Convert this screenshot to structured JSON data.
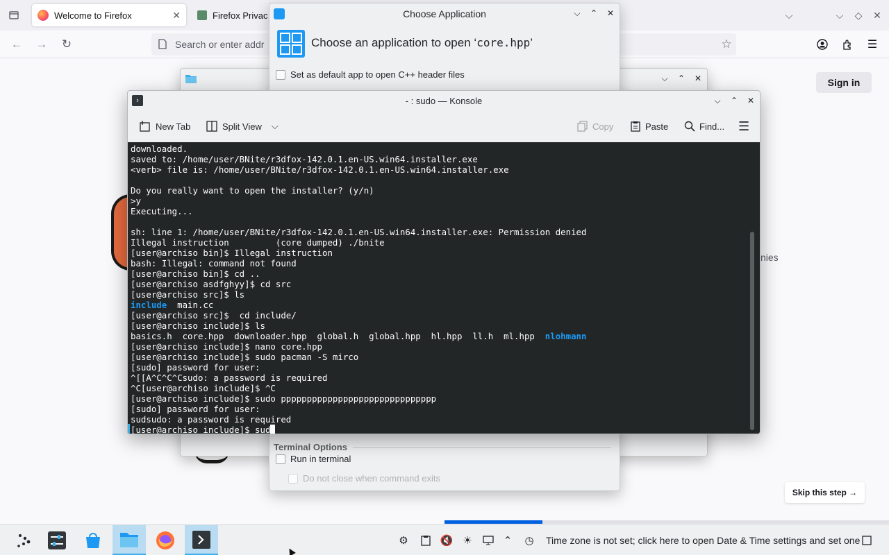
{
  "firefox": {
    "tabs": [
      {
        "title": "Welcome to Firefox",
        "active": true
      },
      {
        "title": "Firefox Privac",
        "active": false
      }
    ],
    "urlbar_placeholder": "Search or enter addr",
    "sign_in": "Sign in",
    "partial_text": "nies",
    "skip_step": "Skip this step →",
    "onboarding_progress": 0.22
  },
  "choose_app": {
    "title": "Choose Application",
    "heading_prefix": "Choose an application to open ‘",
    "heading_file": "core.hpp",
    "heading_suffix": "’",
    "default_checkbox": "Set as default app to open C++ header files",
    "terminal_options_label": "Terminal Options",
    "run_in_terminal": "Run in terminal",
    "do_not_close": "Do not close when command exits"
  },
  "konsole": {
    "title": "- : sudo — Konsole",
    "toolbar": {
      "new_tab": "New Tab",
      "split_view": "Split View",
      "copy": "Copy",
      "paste": "Paste",
      "find": "Find..."
    },
    "lines": [
      [
        {
          "t": "downloaded."
        }
      ],
      [
        {
          "t": "saved to: /home/user/BNite/r3dfox-142.0.1.en-US.win64.installer.exe"
        }
      ],
      [
        {
          "t": "<verb> file is: /home/user/BNite/r3dfox-142.0.1.en-US.win64.installer.exe"
        }
      ],
      [
        {
          "t": ""
        }
      ],
      [
        {
          "t": "Do you really want to open the installer? (y/n)"
        }
      ],
      [
        {
          "t": ">y"
        }
      ],
      [
        {
          "t": "Executing..."
        }
      ],
      [
        {
          "t": ""
        }
      ],
      [
        {
          "t": "sh: line 1: /home/user/BNite/r3dfox-142.0.1.en-US.win64.installer.exe: Permission denied"
        }
      ],
      [
        {
          "t": "Illegal instruction         (core dumped) ./bnite"
        }
      ],
      [
        {
          "t": "[user@archiso bin]$ Illegal instruction"
        }
      ],
      [
        {
          "t": "bash: Illegal: command not found"
        }
      ],
      [
        {
          "t": "[user@archiso bin]$ cd .."
        }
      ],
      [
        {
          "t": "[user@archiso asdfghyy]$ cd src"
        }
      ],
      [
        {
          "t": "[user@archiso src]$ ls"
        }
      ],
      [
        {
          "t": "include",
          "c": "blue"
        },
        {
          "t": "  main.cc"
        }
      ],
      [
        {
          "t": "[user@archiso src]$  cd include/"
        }
      ],
      [
        {
          "t": "[user@archiso include]$ ls"
        }
      ],
      [
        {
          "t": "basics.h  core.hpp  downloader.hpp  global.h  global.hpp  hl.hpp  ll.h  ml.hpp  "
        },
        {
          "t": "nlohmann",
          "c": "blue"
        }
      ],
      [
        {
          "t": "[user@archiso include]$ nano core.hpp"
        }
      ],
      [
        {
          "t": "[user@archiso include]$ sudo pacman -S mirco"
        }
      ],
      [
        {
          "t": "[sudo] password for user:"
        }
      ],
      [
        {
          "t": "^[[A^C^C^Csudo: a password is required"
        }
      ],
      [
        {
          "t": "^C[user@archiso include]$ ^C"
        }
      ],
      [
        {
          "t": "[user@archiso include]$ sudo pppppppppppppppppppppppppppppp"
        }
      ],
      [
        {
          "t": "[sudo] password for user:"
        }
      ],
      [
        {
          "t": "sudsudo: a password is required"
        }
      ],
      [
        {
          "t": "[user@archiso include]$ sud"
        }
      ]
    ]
  },
  "taskbar": {
    "timezone_notice": "Time zone is not set; click here to open Date & Time settings and set one"
  },
  "colors": {
    "accent": "#3daee9",
    "terminal_bg": "#232627",
    "terminal_dir": "#1d99f3",
    "firefox_blue": "#0061e0"
  }
}
